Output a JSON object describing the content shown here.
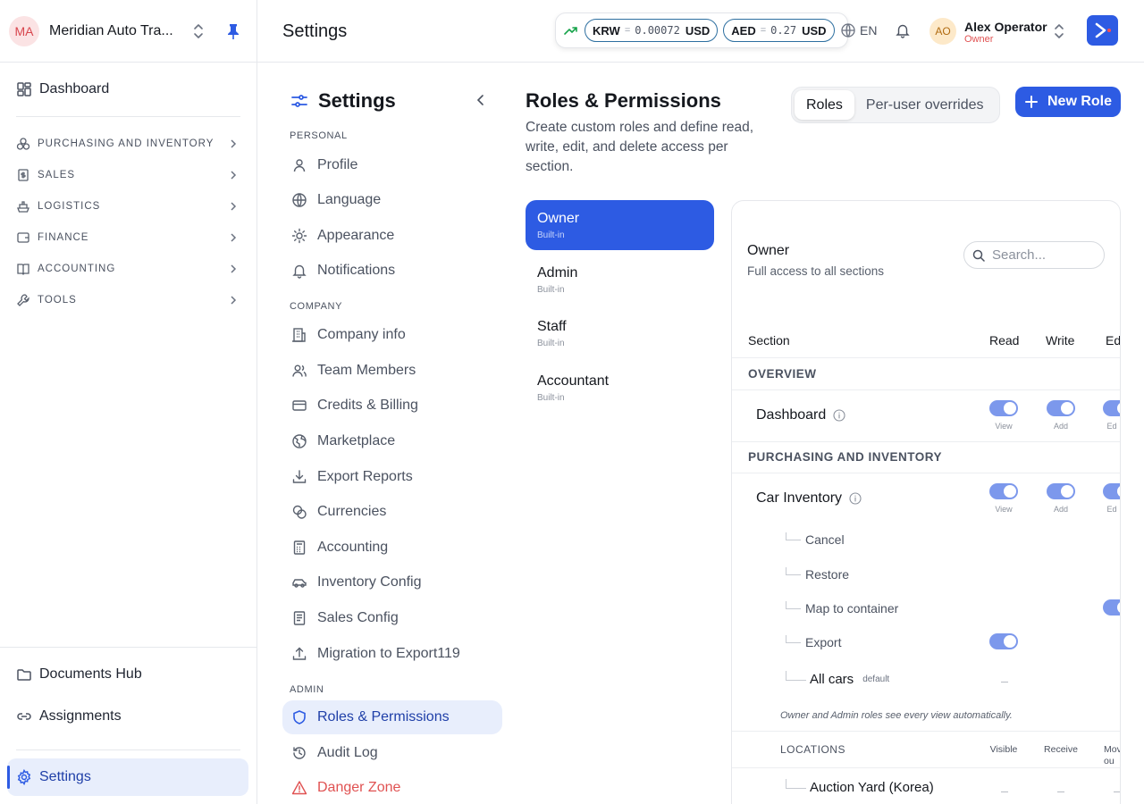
{
  "org": {
    "initials": "MA",
    "name": "Meridian Auto Tra..."
  },
  "nav": {
    "dashboard": "Dashboard",
    "groups": [
      "PURCHASING AND INVENTORY",
      "SALES",
      "LOGISTICS",
      "FINANCE",
      "ACCOUNTING",
      "TOOLS"
    ],
    "documents_hub": "Documents Hub",
    "assignments": "Assignments",
    "settings": "Settings"
  },
  "topbar": {
    "title": "Settings",
    "rates": [
      {
        "currency": "KRW",
        "eq": "=",
        "rate": "0.00072",
        "quote": "USD"
      },
      {
        "currency": "AED",
        "eq": "=",
        "rate": "0.27",
        "quote": "USD"
      }
    ],
    "language": "EN",
    "user": {
      "initials": "AO",
      "name": "Alex Operator",
      "role": "Owner"
    }
  },
  "settings_menu": {
    "title": "Settings",
    "personal_label": "PERSONAL",
    "personal": [
      "Profile",
      "Language",
      "Appearance",
      "Notifications"
    ],
    "company_label": "COMPANY",
    "company": [
      "Company info",
      "Team Members",
      "Credits & Billing",
      "Marketplace",
      "Export Reports",
      "Currencies",
      "Accounting",
      "Inventory Config",
      "Sales Config",
      "Migration to Export119"
    ],
    "admin_label": "ADMIN",
    "admin": [
      "Roles & Permissions",
      "Audit Log",
      "Danger Zone"
    ]
  },
  "roles_page": {
    "title": "Roles & Permissions",
    "description": "Create custom roles and define read, write, edit, and delete access per section.",
    "tabs": [
      "Roles",
      "Per-user overrides"
    ],
    "new_role": "New Role",
    "roles": [
      {
        "name": "Owner",
        "type": "Built-in"
      },
      {
        "name": "Admin",
        "type": "Built-in"
      },
      {
        "name": "Staff",
        "type": "Built-in"
      },
      {
        "name": "Accountant",
        "type": "Built-in"
      }
    ]
  },
  "panel": {
    "role_name": "Owner",
    "role_desc": "Full access to all sections",
    "search_placeholder": "Search...",
    "columns": {
      "section": "Section",
      "read": "Read",
      "write": "Write",
      "edit": "Ed"
    },
    "overview_label": "OVERVIEW",
    "dashboard": {
      "label": "Dashboard",
      "read_cap": "View",
      "write_cap": "Add",
      "edit_cap": "Ed"
    },
    "purchasing_label": "PURCHASING AND INVENTORY",
    "car_inventory": {
      "label": "Car Inventory",
      "read_cap": "View",
      "write_cap": "Add",
      "edit_cap": "Ed"
    },
    "sub_actions": [
      "Cancel",
      "Restore",
      "Map to container",
      "Export"
    ],
    "all_cars": {
      "label": "All cars",
      "tag": "default"
    },
    "note": "Owner and Admin roles see every view automatically.",
    "locations": {
      "label": "LOCATIONS",
      "visible": "Visible",
      "receive": "Receive",
      "move": "Mov\nou"
    },
    "auction_yard": "Auction Yard (Korea)"
  }
}
